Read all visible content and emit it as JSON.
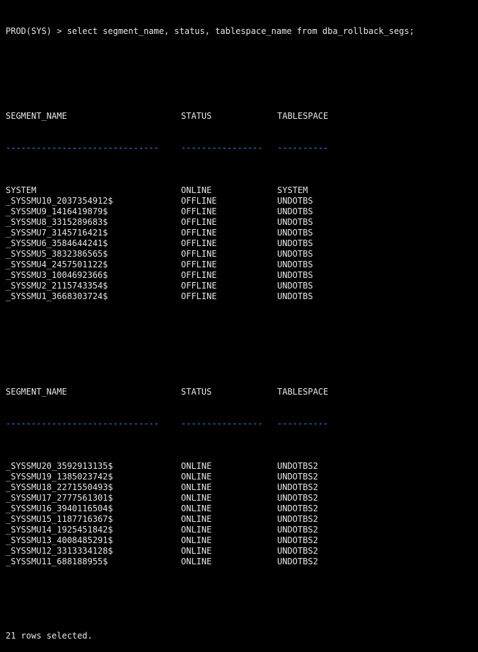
{
  "command_line": "PROD(SYS) > select segment_name, status, tablespace_name from dba_rollback_segs;",
  "headers": {
    "segment_name": "SEGMENT_NAME",
    "status": "STATUS",
    "tablespace": "TABLESPACE"
  },
  "separators": {
    "segment_name": "------------------------------",
    "status": "----------------",
    "tablespace": "----------"
  },
  "group1": [
    {
      "segment_name": "SYSTEM",
      "status": "ONLINE",
      "tablespace": "SYSTEM"
    },
    {
      "segment_name": "_SYSSMU10_2037354912$",
      "status": "OFFLINE",
      "tablespace": "UNDOTBS"
    },
    {
      "segment_name": "_SYSSMU9_1416419879$",
      "status": "OFFLINE",
      "tablespace": "UNDOTBS"
    },
    {
      "segment_name": "_SYSSMU8_3315289683$",
      "status": "OFFLINE",
      "tablespace": "UNDOTBS"
    },
    {
      "segment_name": "_SYSSMU7_3145716421$",
      "status": "OFFLINE",
      "tablespace": "UNDOTBS"
    },
    {
      "segment_name": "_SYSSMU6_3584644241$",
      "status": "OFFLINE",
      "tablespace": "UNDOTBS"
    },
    {
      "segment_name": "_SYSSMU5_3832386565$",
      "status": "OFFLINE",
      "tablespace": "UNDOTBS"
    },
    {
      "segment_name": "_SYSSMU4_2457501122$",
      "status": "OFFLINE",
      "tablespace": "UNDOTBS"
    },
    {
      "segment_name": "_SYSSMU3_1004692366$",
      "status": "OFFLINE",
      "tablespace": "UNDOTBS"
    },
    {
      "segment_name": "_SYSSMU2_2115743354$",
      "status": "OFFLINE",
      "tablespace": "UNDOTBS"
    },
    {
      "segment_name": "_SYSSMU1_3668303724$",
      "status": "OFFLINE",
      "tablespace": "UNDOTBS"
    }
  ],
  "group2": [
    {
      "segment_name": "_SYSSMU20_3592913135$",
      "status": "ONLINE",
      "tablespace": "UNDOTBS2"
    },
    {
      "segment_name": "_SYSSMU19_1385023742$",
      "status": "ONLINE",
      "tablespace": "UNDOTBS2"
    },
    {
      "segment_name": "_SYSSMU18_2271550493$",
      "status": "ONLINE",
      "tablespace": "UNDOTBS2"
    },
    {
      "segment_name": "_SYSSMU17_2777561301$",
      "status": "ONLINE",
      "tablespace": "UNDOTBS2"
    },
    {
      "segment_name": "_SYSSMU16_3940116504$",
      "status": "ONLINE",
      "tablespace": "UNDOTBS2"
    },
    {
      "segment_name": "_SYSSMU15_1187716367$",
      "status": "ONLINE",
      "tablespace": "UNDOTBS2"
    },
    {
      "segment_name": "_SYSSMU14_1925451842$",
      "status": "ONLINE",
      "tablespace": "UNDOTBS2"
    },
    {
      "segment_name": "_SYSSMU13_4008485291$",
      "status": "ONLINE",
      "tablespace": "UNDOTBS2"
    },
    {
      "segment_name": "_SYSSMU12_3313334128$",
      "status": "ONLINE",
      "tablespace": "UNDOTBS2"
    },
    {
      "segment_name": "_SYSSMU11_688188955$",
      "status": "ONLINE",
      "tablespace": "UNDOTBS2"
    }
  ],
  "footer": "21 rows selected.",
  "colors": {
    "background": "#000000",
    "text": "#e6e6e6",
    "separator": "#3a8bff"
  }
}
